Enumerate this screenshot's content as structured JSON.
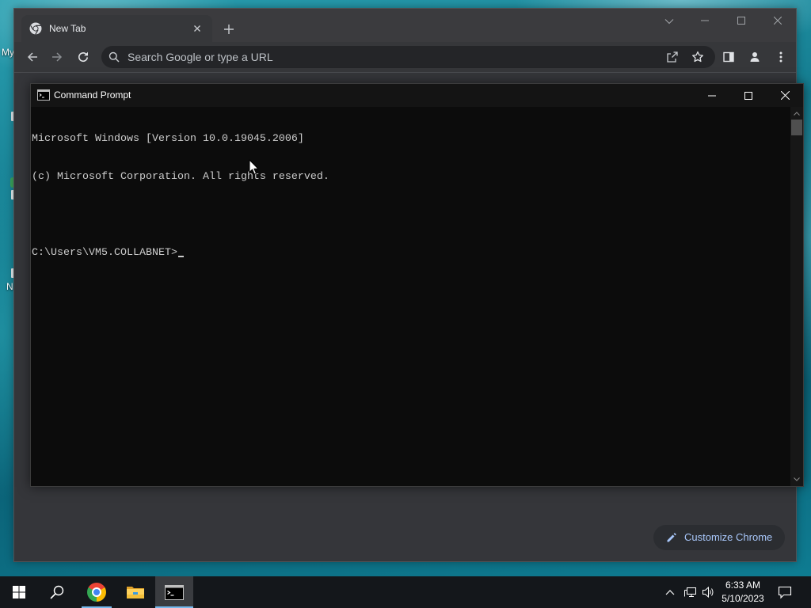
{
  "desktop": {
    "icon_labels": [
      "My",
      "N"
    ]
  },
  "chrome": {
    "tab_title": "New Tab",
    "tab_favicon": "chrome-icon",
    "omnibox_placeholder": "Search Google or type a URL",
    "customize_label": "Customize Chrome",
    "toolbar_icons": [
      "back-arrow-icon",
      "forward-arrow-icon",
      "reload-icon",
      "search-icon",
      "share-icon",
      "star-icon",
      "side-panel-icon",
      "profile-icon",
      "menu-icon"
    ],
    "forward_enabled": false
  },
  "cmd": {
    "title": "Command Prompt",
    "lines": [
      "Microsoft Windows [Version 10.0.19045.2006]",
      "(c) Microsoft Corporation. All rights reserved."
    ],
    "prompt": "C:\\Users\\VM5.COLLABNET>"
  },
  "taskbar": {
    "apps": [
      {
        "icon": "windows-start-icon"
      },
      {
        "icon": "search-icon"
      },
      {
        "icon": "chrome-icon",
        "running": true,
        "focused": false
      },
      {
        "icon": "file-explorer-icon",
        "running": false,
        "focused": false
      },
      {
        "icon": "command-prompt-icon",
        "running": true,
        "focused": true
      }
    ],
    "tray_icons": [
      "chevron-up-icon",
      "network-icon",
      "volume-icon",
      "notification-icon"
    ],
    "time": "6:33 AM",
    "date": "5/10/2023"
  },
  "colors": {
    "console_bg": "#0c0c0c",
    "console_text": "#cccccc",
    "chrome_accent": "#a8c7fa",
    "taskbar_indicator": "#76b9ed"
  }
}
